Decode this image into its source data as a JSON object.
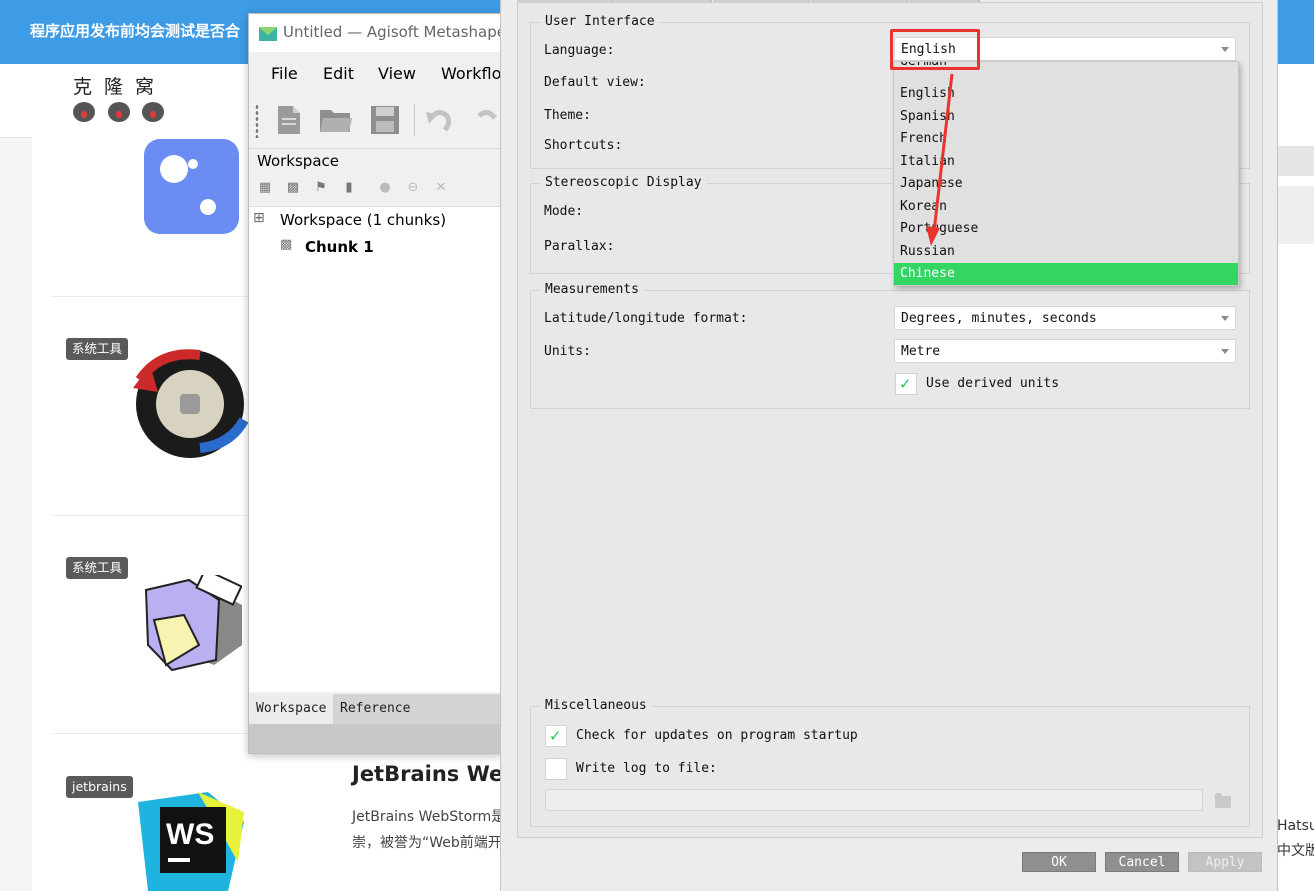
{
  "website": {
    "banner_title": "程序应用发布前均会测试是否合",
    "logo_text": "克隆窝",
    "tags": [
      "系统工具",
      "系统工具",
      "jetbrains"
    ],
    "article_heading": "JetBrains WebS",
    "article_desc_line1": "JetBrains WebStorm是",
    "article_desc_line2": "崇，被誉为“Web前端开",
    "right_text_1": "Hatsu",
    "right_text_2": "中文版"
  },
  "metashape": {
    "title": "Untitled — Agisoft Metashape Pr",
    "menu": [
      "File",
      "Edit",
      "View",
      "Workflow"
    ],
    "toolbar_icons": [
      "new-document-icon",
      "open-folder-icon",
      "save-icon",
      "undo-icon",
      "redo-icon"
    ],
    "workspace_label": "Workspace",
    "tree": {
      "workspace": "Workspace (1 chunks)",
      "chunk": "Chunk 1"
    },
    "tabs": [
      "Workspace",
      "Reference"
    ]
  },
  "preferences": {
    "user_interface": {
      "title": "User Interface",
      "language_label": "Language:",
      "language_value": "English",
      "default_view_label": "Default view:",
      "theme_label": "Theme:",
      "shortcuts_label": "Shortcuts:"
    },
    "language_options": [
      "German",
      "English",
      "Spanish",
      "French",
      "Italian",
      "Japanese",
      "Korean",
      "Portuguese",
      "Russian",
      "Chinese"
    ],
    "language_highlighted": "Chinese",
    "stereo": {
      "title": "Stereoscopic Display",
      "mode_label": "Mode:",
      "parallax_label": "Parallax:"
    },
    "measurements": {
      "title": "Measurements",
      "latlon_label": "Latitude/longitude format:",
      "latlon_value": "Degrees, minutes, seconds",
      "units_label": "Units:",
      "units_value": "Metre",
      "derived_units_label": "Use derived units",
      "derived_units_checked": true
    },
    "misc": {
      "title": "Miscellaneous",
      "check_updates_label": "Check for updates on program startup",
      "check_updates_checked": true,
      "write_log_label": "Write log to file:",
      "write_log_checked": false,
      "log_path": ""
    },
    "buttons": {
      "ok": "OK",
      "cancel": "Cancel",
      "apply": "Apply"
    }
  },
  "colors": {
    "highlight": "#33d663",
    "annotation_red": "#e8342c",
    "site_banner": "#3e9be6"
  }
}
